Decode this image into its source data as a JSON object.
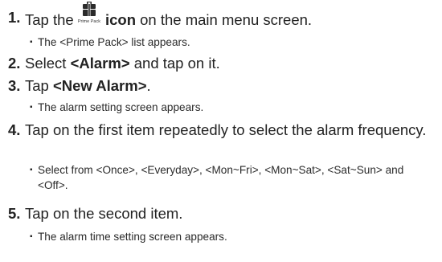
{
  "steps": [
    {
      "number": "1.",
      "text_before": "Tap the",
      "icon_name": "prime-pack-icon",
      "icon_caption": "Prime Pack",
      "text_after": "icon",
      "text_rest": " on the main menu screen.",
      "notes": [
        "The <Prime Pack> list appears."
      ]
    },
    {
      "number": "2.",
      "text_before": "Select ",
      "bold": "<Alarm>",
      "text_after": " and tap on it."
    },
    {
      "number": "3.",
      "text_before": "Tap ",
      "bold": "<New Alarm>",
      "text_after": ".",
      "notes": [
        "The alarm setting screen appears."
      ]
    },
    {
      "number": "4.",
      "text": "Tap on the first item repeatedly to select the alarm frequency.",
      "notes": [
        "Select from <Once>, <Everyday>, <Mon~Fri>, <Mon~Sat>, <Sat~Sun> and <Off>."
      ]
    },
    {
      "number": "5.",
      "text": "Tap on the second item.",
      "notes": [
        "The alarm time setting screen appears."
      ]
    }
  ],
  "bullet_glyph": "▪"
}
